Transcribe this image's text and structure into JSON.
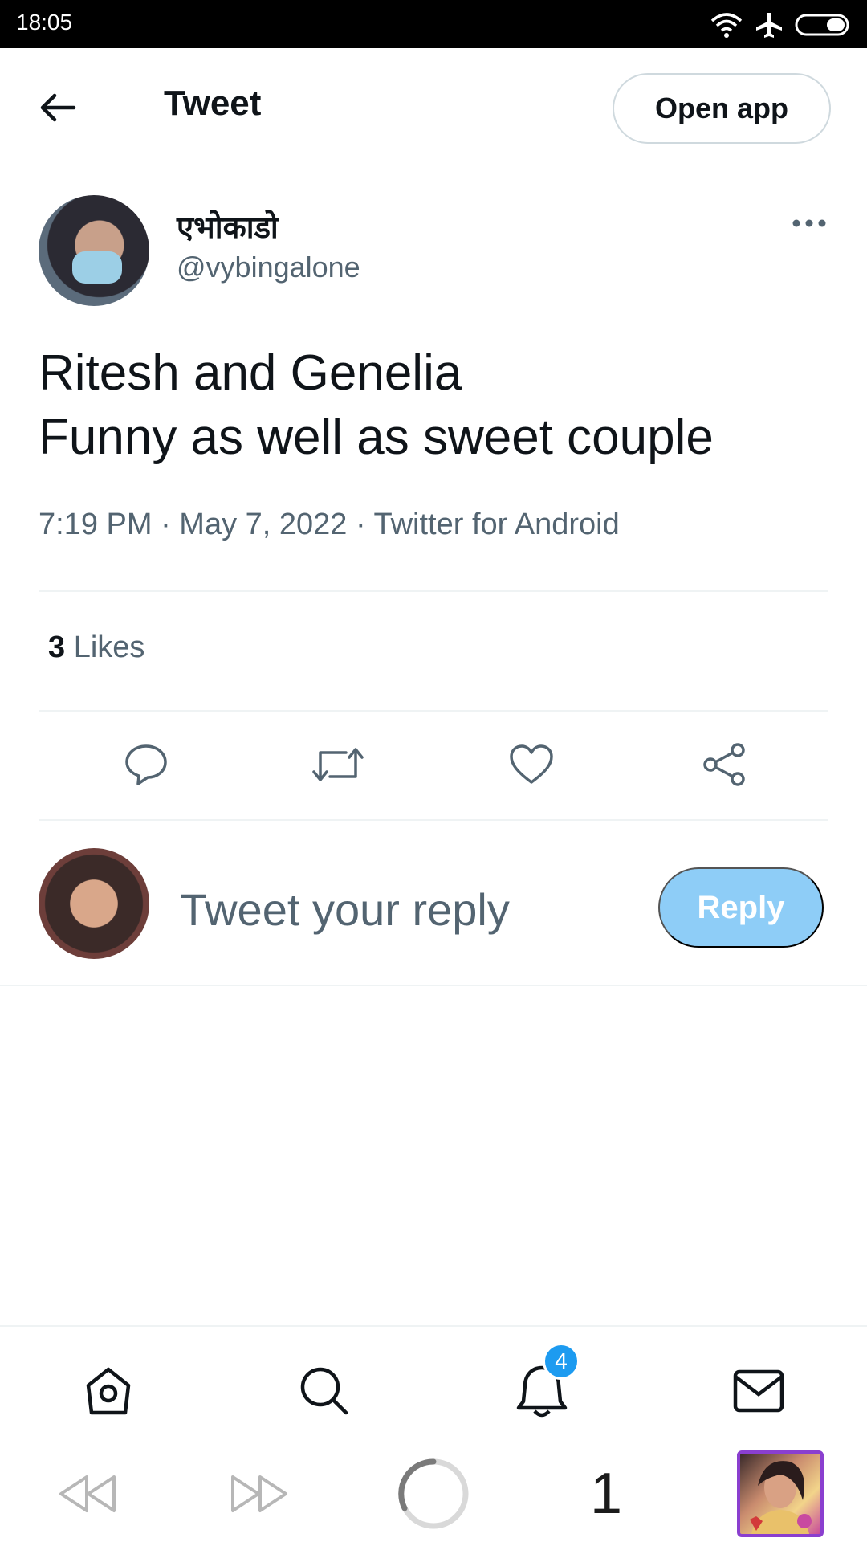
{
  "status_bar": {
    "time": "18:05"
  },
  "header": {
    "title": "Tweet",
    "open_app_label": "Open app"
  },
  "tweet": {
    "author_name": "एभोकाडो",
    "author_handle": "@vybingalone",
    "text_line1": "Ritesh and Genelia",
    "text_line2": "Funny as well as sweet couple",
    "meta": "7:19 PM · May 7, 2022 · Twitter for Android",
    "likes_count": "3",
    "likes_label": "Likes"
  },
  "reply": {
    "placeholder": "Tweet your reply",
    "button_label": "Reply"
  },
  "bottom_nav": {
    "notifications_badge": "4"
  },
  "browser_bar": {
    "tab_count": "1"
  },
  "colors": {
    "accent": "#1d9bf0",
    "reply_button": "#8ecdf7",
    "secondary_text": "#536471"
  }
}
